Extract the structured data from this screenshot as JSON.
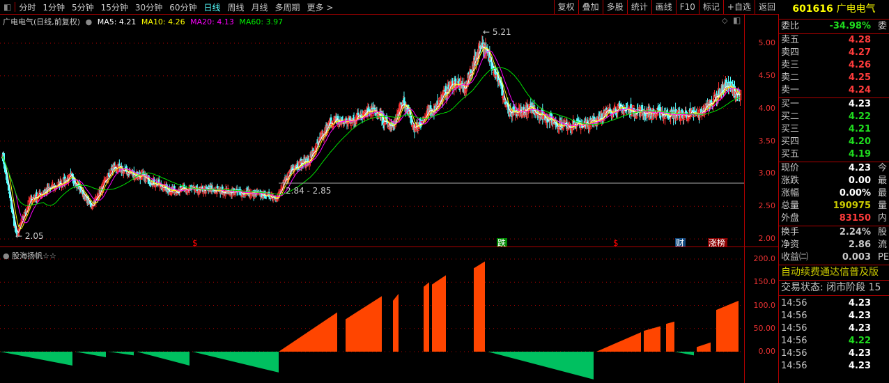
{
  "topbar": {
    "tabs": [
      "分时",
      "1分钟",
      "5分钟",
      "15分钟",
      "30分钟",
      "60分钟",
      "日线",
      "周线",
      "月线",
      "多周期",
      "更多 >"
    ],
    "active": "日线"
  },
  "toolbar": [
    "复权",
    "叠加",
    "多股",
    "统计",
    "画线",
    "F10",
    "标记",
    "+自选",
    "返回"
  ],
  "legend": {
    "title": "广电电气(日线,前复权)",
    "ma5": "MA5: 4.21",
    "ma10": "MA10: 4.26",
    "ma20": "MA20: 4.13",
    "ma60": "MA60: 3.97"
  },
  "colors": {
    "up": "#ff3232",
    "down": "#54ffff",
    "ma5": "#ffffff",
    "ma10": "#ffff00",
    "ma20": "#ff00ff",
    "ma60": "#00e000",
    "ind_pos": "#ff4500",
    "ind_neg": "#00c060",
    "grid": "#b00000"
  },
  "chart_data": {
    "type": "candlestick",
    "price_axis": {
      "ticks": [
        "5.00",
        "4.50",
        "4.00",
        "3.50",
        "3.00",
        "2.50",
        "2.00"
      ],
      "range": [
        2.0,
        5.0
      ]
    },
    "annotations": {
      "high": "5.21",
      "low": "2.05",
      "range_label": "2.84 - 2.85"
    },
    "close_keypoints": [
      [
        0,
        3.3
      ],
      [
        5,
        2.05
      ],
      [
        10,
        2.6
      ],
      [
        25,
        2.95
      ],
      [
        32,
        2.5
      ],
      [
        40,
        3.1
      ],
      [
        50,
        2.95
      ],
      [
        60,
        2.75
      ],
      [
        75,
        2.75
      ],
      [
        88,
        2.7
      ],
      [
        99,
        2.65
      ],
      [
        104,
        3.1
      ],
      [
        110,
        3.2
      ],
      [
        118,
        3.8
      ],
      [
        125,
        3.8
      ],
      [
        132,
        4.0
      ],
      [
        140,
        3.7
      ],
      [
        144,
        4.1
      ],
      [
        148,
        3.7
      ],
      [
        155,
        4.0
      ],
      [
        162,
        4.4
      ],
      [
        166,
        4.3
      ],
      [
        172,
        5.0
      ],
      [
        177,
        4.6
      ],
      [
        182,
        3.9
      ],
      [
        190,
        4.0
      ],
      [
        200,
        3.75
      ],
      [
        210,
        3.75
      ],
      [
        220,
        4.0
      ],
      [
        230,
        3.95
      ],
      [
        242,
        3.9
      ],
      [
        250,
        3.9
      ],
      [
        260,
        4.35
      ],
      [
        265,
        4.2
      ]
    ],
    "indicator": {
      "title": "股海扬帆☆☆",
      "ticks": [
        "200.0",
        "150.0",
        "100.0",
        "50.00",
        "0.00"
      ],
      "range": [
        -70,
        215
      ],
      "segments": [
        [
          0,
          26,
          0,
          -30
        ],
        [
          27,
          38,
          0,
          -12
        ],
        [
          39,
          48,
          0,
          -8
        ],
        [
          49,
          68,
          0,
          -30
        ],
        [
          69,
          100,
          0,
          -45
        ],
        [
          100,
          121,
          0,
          85
        ],
        [
          124,
          137,
          70,
          120
        ],
        [
          141,
          143,
          110,
          125
        ],
        [
          152,
          154,
          140,
          150
        ],
        [
          155,
          160,
          145,
          165
        ],
        [
          170,
          174,
          180,
          195
        ],
        [
          175,
          213,
          0,
          -60
        ],
        [
          214,
          230,
          0,
          42
        ],
        [
          231,
          237,
          45,
          55
        ],
        [
          239,
          242,
          60,
          65
        ],
        [
          242,
          249,
          0,
          -8
        ],
        [
          250,
          255,
          10,
          20
        ],
        [
          257,
          265,
          90,
          110
        ]
      ]
    },
    "event_markers": [
      "$",
      "跌",
      "$",
      "财",
      "涨榜"
    ]
  },
  "quote": {
    "code": "601616",
    "name": "广电电气",
    "weibi": {
      "label": "委比",
      "value": "-34.98%",
      "extra": "委"
    },
    "sell": [
      {
        "l": "卖五",
        "v": "4.28"
      },
      {
        "l": "卖四",
        "v": "4.27"
      },
      {
        "l": "卖三",
        "v": "4.26"
      },
      {
        "l": "卖二",
        "v": "4.25"
      },
      {
        "l": "卖一",
        "v": "4.24"
      }
    ],
    "buy": [
      {
        "l": "买一",
        "v": "4.23"
      },
      {
        "l": "买二",
        "v": "4.22"
      },
      {
        "l": "买三",
        "v": "4.21"
      },
      {
        "l": "买四",
        "v": "4.20"
      },
      {
        "l": "买五",
        "v": "4.19"
      }
    ],
    "stats": [
      {
        "l": "现价",
        "v": "4.23",
        "e": "今",
        "c": "wht"
      },
      {
        "l": "涨跌",
        "v": "0.00",
        "e": "最",
        "c": "wht"
      },
      {
        "l": "涨幅",
        "v": "0.00%",
        "e": "最",
        "c": "wht"
      },
      {
        "l": "总量",
        "v": "190975",
        "e": "量",
        "c": "yel"
      },
      {
        "l": "外盘",
        "v": "83150",
        "e": "内",
        "c": "red"
      }
    ],
    "fin": [
      {
        "l": "换手",
        "v": "2.24%",
        "e": "股"
      },
      {
        "l": "净资",
        "v": "2.86",
        "e": "流"
      },
      {
        "l": "收益㈡",
        "v": "0.003",
        "e": "PE"
      }
    ],
    "notice": "自动续费通达信普及版",
    "status": "交易状态: 闭市阶段 15",
    "ticks": [
      {
        "t": "14:56",
        "v": "4.23",
        "c": "wht"
      },
      {
        "t": "14:56",
        "v": "4.23",
        "c": "wht"
      },
      {
        "t": "14:56",
        "v": "4.23",
        "c": "wht"
      },
      {
        "t": "14:56",
        "v": "4.22",
        "c": "grn"
      },
      {
        "t": "14:56",
        "v": "4.23",
        "c": "wht"
      },
      {
        "t": "14:56",
        "v": "4.23",
        "c": "wht"
      }
    ]
  }
}
